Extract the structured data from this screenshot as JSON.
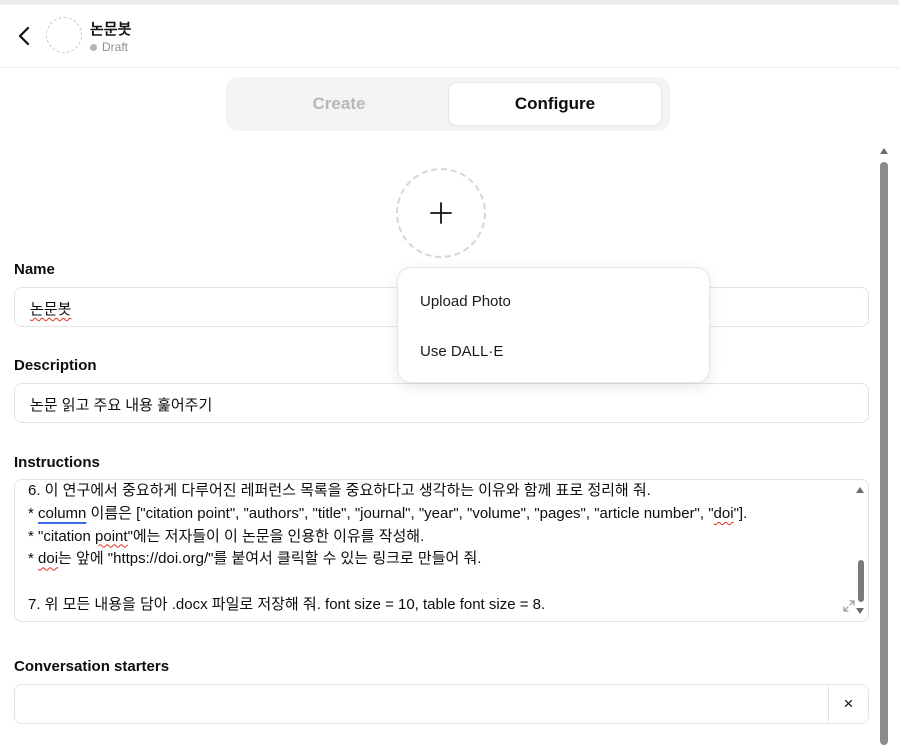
{
  "header": {
    "gpt_name": "논문봇",
    "status": "Draft"
  },
  "tabs": {
    "create": "Create",
    "configure": "Configure",
    "active": "Configure"
  },
  "photo_menu": {
    "upload": "Upload Photo",
    "dalle": "Use DALL·E"
  },
  "form": {
    "name_label": "Name",
    "name_value": "논문봇",
    "description_label": "Description",
    "description_value": "논문 읽고 주요 내용 훑어주기",
    "instructions_label": "Instructions",
    "instructions_lines": {
      "l1": "6. 이 연구에서 중요하게 다루어진 레퍼런스 목록을 중요하다고 생각하는 이유와 함께 표로 정리해 줘.",
      "l2_a": "* ",
      "l2_b": "column",
      "l2_c": " 이름은 [\"citation point\", \"authors\", \"title\", \"journal\", \"year\", \"volume\", \"pages\", \"article number\", \"",
      "l2_d": "doi",
      "l2_e": "\"].",
      "l3_a": "* \"citation ",
      "l3_b": "point",
      "l3_c": "\"에는 저자들이 이 논문을 인용한 이유를 작성해.",
      "l4_a": "* ",
      "l4_b": "doi",
      "l4_c": "는 앞에 \"https://doi.org/\"를 붙여서 클릭할 수 있는 링크로 만들어 줘.",
      "l5": "",
      "l6": "7. 위 모든 내용을 담아 .docx 파일로 저장해 줘. font size = 10, table font size = 8."
    },
    "starters_label": "Conversation starters",
    "starter_value": "",
    "clear_icon": "×"
  },
  "icons": {
    "back": "chevron-left-icon",
    "add_photo": "plus-icon",
    "resize": "resize-icon",
    "clear": "close-icon"
  },
  "colors": {
    "spellcheck": "#e0341f",
    "link_underline": "#3b6fe0",
    "muted_tab": "#b7b7b7"
  }
}
